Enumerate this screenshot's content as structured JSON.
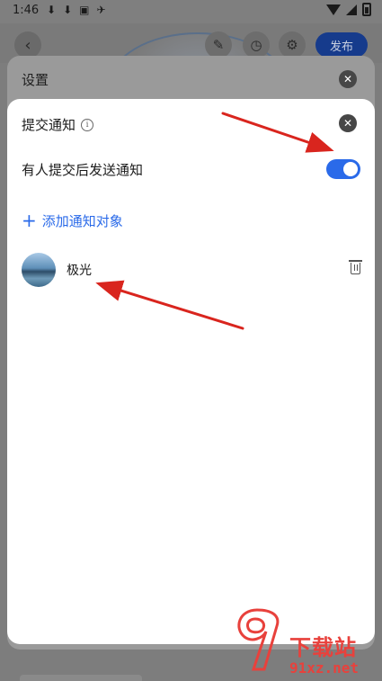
{
  "status_bar": {
    "time": "1:46",
    "icons": [
      "download-icon",
      "download-icon",
      "app-icon",
      "bird-icon"
    ]
  },
  "app_bar": {
    "back_icon": "chevron-left-icon",
    "tools": [
      "palette-icon",
      "timer-icon",
      "gear-icon"
    ],
    "publish_label": "发布"
  },
  "settings_sheet": {
    "title": "设置",
    "close_icon": "close-icon"
  },
  "notify_sheet": {
    "title": "提交通知",
    "info_icon": "info-icon",
    "toggle_label": "有人提交后发送通知",
    "toggle_on": true,
    "add_label": "添加通知对象",
    "members": [
      {
        "name": "极光"
      }
    ]
  },
  "colors": {
    "accent": "#2a6ae9",
    "publish": "#163b8c",
    "annotation": "#d9251e"
  },
  "watermark": {
    "title": "下载站",
    "url": "91xz.net"
  }
}
